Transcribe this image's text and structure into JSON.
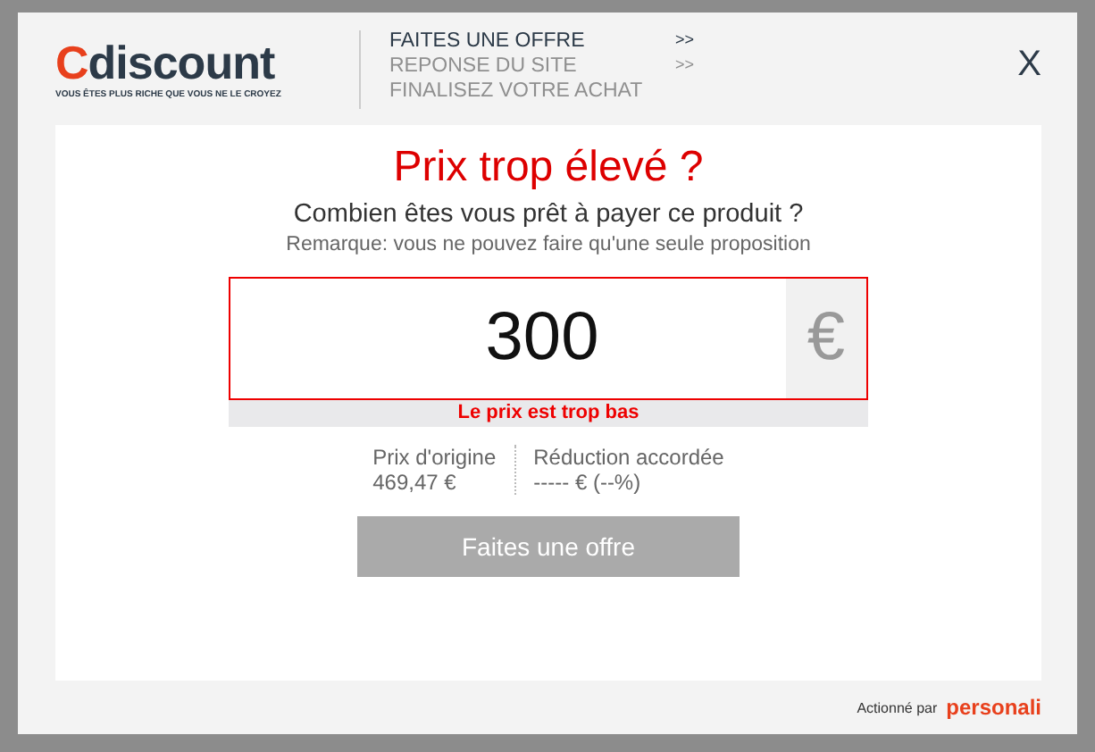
{
  "logo": {
    "first_letter": "C",
    "rest": "discount",
    "tagline": "VOUS ÊTES PLUS RICHE QUE VOUS NE LE CROYEZ"
  },
  "steps": [
    {
      "label": "FAITES UNE OFFRE",
      "arrow": ">>",
      "selected": true
    },
    {
      "label": "REPONSE DU SITE",
      "arrow": ">>",
      "selected": false
    },
    {
      "label": "FINALISEZ VOTRE ACHAT",
      "selected": false
    }
  ],
  "close": "X",
  "title": "Prix trop élevé ?",
  "question": "Combien êtes vous prêt à payer ce produit ?",
  "remark": "Remarque: vous ne pouvez faire qu'une seule proposition",
  "offer": {
    "value": "300",
    "currency": "€",
    "error": "Le prix est trop bas"
  },
  "prices": [
    {
      "label": "Prix d'origine",
      "value": "469,47 €"
    },
    {
      "label": "Réduction accordée",
      "value": "----- € (--%)"
    }
  ],
  "submit": {
    "label": "Faites une offre",
    "disabled": true
  },
  "footer": {
    "text": "Actionné par",
    "brand": "personali"
  }
}
